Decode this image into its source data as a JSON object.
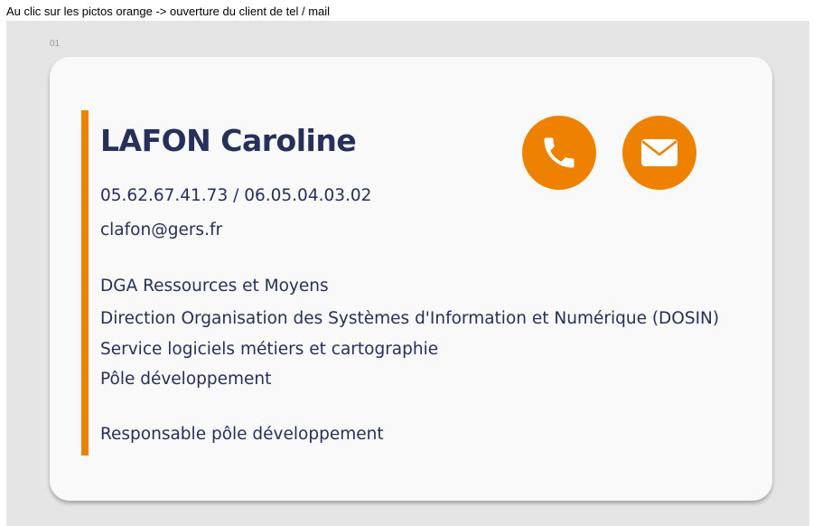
{
  "note": "Au clic sur les pictos orange -> ouverture du client de tel / mail",
  "frame_label": "01",
  "colors": {
    "accent": "#ee8200",
    "text": "#26305a",
    "card": "#f9f9f9",
    "canvas": "#e5e5e5"
  },
  "card": {
    "name": "LAFON Caroline",
    "phones": "05.62.67.41.73 / 06.05.04.03.02",
    "email": "clafon@gers.fr",
    "departments": [
      "DGA Ressources et Moyens",
      "Direction Organisation des Systèmes d'Information et Numérique (DOSIN)",
      "Service logiciels métiers et cartographie",
      "Pôle développement"
    ],
    "job_title": "Responsable pôle développement"
  },
  "icons": {
    "phone": "phone-icon",
    "mail": "mail-icon"
  }
}
